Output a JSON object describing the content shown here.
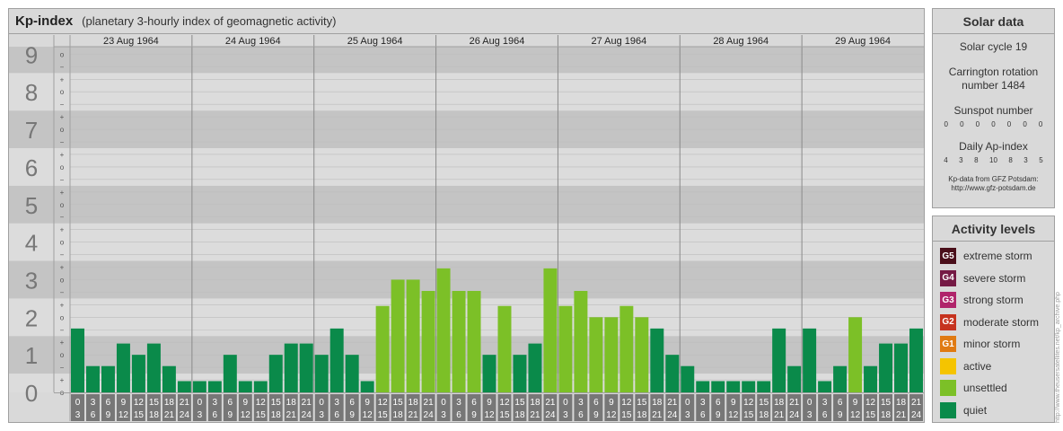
{
  "header": {
    "title": "Kp-index",
    "subtitle": "(planetary 3-hourly index of geomagnetic activity)"
  },
  "solar": {
    "title": "Solar data",
    "cycle": "Solar cycle 19",
    "carrington": "Carrington rotation number 1484",
    "sunspot_label": "Sunspot number",
    "sunspot_values": [
      "0",
      "0",
      "0",
      "0",
      "0",
      "0",
      "0"
    ],
    "ap_label": "Daily Ap-index",
    "ap_values": [
      "4",
      "3",
      "8",
      "10",
      "8",
      "3",
      "5"
    ],
    "source_line1": "Kp-data from GFZ Potsdam:",
    "source_line2": "http://www.gfz-potsdam.de"
  },
  "activity": {
    "title": "Activity levels",
    "items": [
      {
        "badge": "G5",
        "label": "extreme storm",
        "color": "#4a0f1a"
      },
      {
        "badge": "G4",
        "label": "severe storm",
        "color": "#751a45"
      },
      {
        "badge": "G3",
        "label": "strong storm",
        "color": "#b0246b"
      },
      {
        "badge": "G2",
        "label": "moderate storm",
        "color": "#c6321e"
      },
      {
        "badge": "G1",
        "label": "minor storm",
        "color": "#e07a12"
      },
      {
        "badge": "",
        "label": "active",
        "color": "#f5c400"
      },
      {
        "badge": "",
        "label": "unsettled",
        "color": "#7cc027"
      },
      {
        "badge": "",
        "label": "quiet",
        "color": "#0a8a4a"
      }
    ]
  },
  "watermark": "http://www.theusersatellites.net/kp_archive.php",
  "chart_data": {
    "type": "bar",
    "title": "Kp-index",
    "subtitle": "(planetary 3-hourly index of geomagnetic activity)",
    "ylim": [
      0,
      9
    ],
    "y_ticks": [
      "0",
      "1",
      "2",
      "3",
      "4",
      "5",
      "6",
      "7",
      "8",
      "9"
    ],
    "y_minor_labels": [
      "+",
      "o",
      "−"
    ],
    "days": [
      "23 Aug 1964",
      "24 Aug 1964",
      "25 Aug 1964",
      "26 Aug 1964",
      "27 Aug 1964",
      "28 Aug 1964",
      "29 Aug 1964"
    ],
    "interval_start": [
      "0",
      "3",
      "6",
      "9",
      "12",
      "15",
      "18",
      "21"
    ],
    "interval_end": [
      "3",
      "6",
      "9",
      "12",
      "15",
      "18",
      "21",
      "24"
    ],
    "values": [
      [
        1.7,
        0.7,
        0.7,
        1.3,
        1.0,
        1.3,
        0.7,
        0.3
      ],
      [
        0.3,
        0.3,
        1.0,
        0.3,
        0.3,
        1.0,
        1.3,
        1.3
      ],
      [
        1.0,
        1.7,
        1.0,
        0.3,
        2.3,
        3.0,
        3.0,
        2.7
      ],
      [
        3.3,
        2.7,
        2.7,
        1.0,
        2.3,
        1.0,
        1.3,
        3.3
      ],
      [
        2.3,
        2.7,
        2.0,
        2.0,
        2.3,
        2.0,
        1.7,
        1.0
      ],
      [
        0.7,
        0.3,
        0.3,
        0.3,
        0.3,
        0.3,
        1.7,
        0.7
      ],
      [
        1.7,
        0.3,
        0.7,
        2.0,
        0.7,
        1.3,
        1.3,
        1.7
      ]
    ],
    "thresholds": {
      "quiet_max": 1.7,
      "unsettled_max": 3.7,
      "active_max": 4.7
    },
    "colors": {
      "quiet": "#0a8a4a",
      "unsettled": "#7cc027",
      "active": "#f5c400",
      "band_dark": "#c4c4c4",
      "band_light": "#dcdcdc",
      "day_label_bg": "#e8e8e8",
      "axis_box": "#777777"
    }
  }
}
